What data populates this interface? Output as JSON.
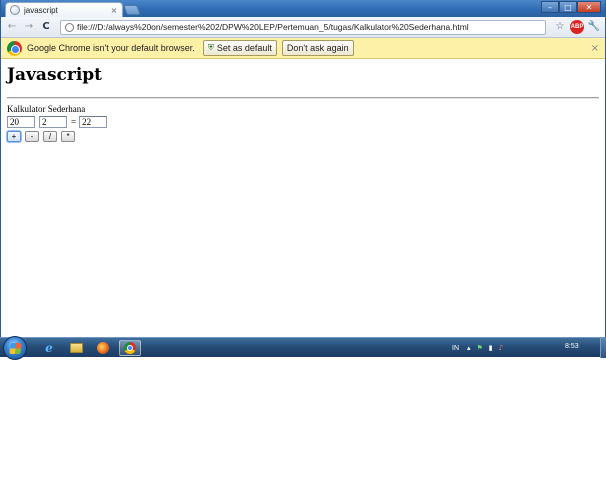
{
  "browser": {
    "tab_title": "javascript",
    "tab_close": "×",
    "window_controls": {
      "minimize": "–",
      "maximize": "□",
      "close": "✕"
    },
    "nav": {
      "back": "←",
      "forward": "→",
      "reload": "C"
    },
    "url": "file:///D:/always%20on/semester%202/DPW%20LEP/Pertemuan_5/tugas/Kalkulator%20Sederhana.html",
    "toolbar_icons": {
      "star": "☆",
      "adblock": "ABP",
      "wrench": "🔧"
    },
    "icons": [
      "page-icon",
      "star-icon",
      "adblock-icon",
      "wrench-icon"
    ]
  },
  "infobar": {
    "message": "Google Chrome isn't your default browser.",
    "set_default_label": "Set as default",
    "dont_ask_label": "Don't ask again",
    "close": "×",
    "colors": {
      "background": "#fdf1a8"
    }
  },
  "page": {
    "heading": "Javascript",
    "calc_title": "Kalkulator Sederhana",
    "input1_value": "20",
    "input2_value": "2",
    "equals": "=",
    "result_value": "22",
    "operators": [
      "+",
      "-",
      "/",
      "*"
    ]
  },
  "taskbar": {
    "apps": [
      "internet-explorer",
      "windows-explorer",
      "firefox",
      "chrome"
    ],
    "language": "IN",
    "tray": {
      "arrow": "▴",
      "flag": "⚑",
      "network": "▮",
      "volume": "♪"
    },
    "time": "8:53"
  },
  "colors": {
    "taskbar": "#264d77",
    "titlebar": "#2f6cb3"
  }
}
